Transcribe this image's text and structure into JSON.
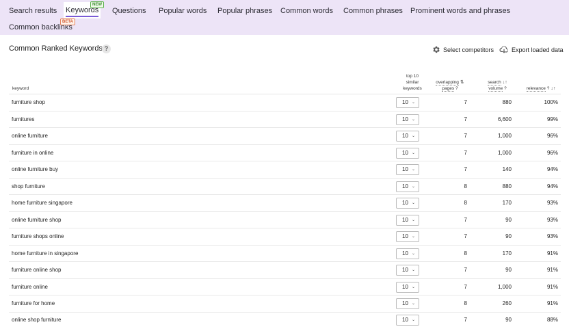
{
  "tabs": [
    {
      "label": "Search results"
    },
    {
      "label": "Keywords",
      "badge": "NEW",
      "active": true
    },
    {
      "label": "Questions"
    },
    {
      "label": "Popular words"
    },
    {
      "label": "Popular phrases"
    },
    {
      "label": "Common words"
    },
    {
      "label": "Common phrases"
    },
    {
      "label": "Prominent words and phrases"
    },
    {
      "label": "Common backlinks",
      "badge": "BETA"
    }
  ],
  "section": {
    "title": "Common Ranked Keywords",
    "help": "?",
    "select_competitors": "Select competitors",
    "export": "Export loaded data"
  },
  "table": {
    "headers": {
      "keyword": "keyword",
      "top10_line1": "top 10",
      "top10_line2": "similar",
      "top10_line3": "keywords",
      "overlap_line1": "overlapping",
      "overlap_line2": "pages",
      "volume_line1": "search",
      "volume_line2": "volume",
      "relevance": "relevance",
      "help_mark": "?"
    },
    "rows": [
      {
        "keyword": "furniture shop",
        "top10": "10",
        "overlap": "7",
        "volume": "880",
        "relevance": "100%"
      },
      {
        "keyword": "furnitures",
        "top10": "10",
        "overlap": "7",
        "volume": "6,600",
        "relevance": "99%"
      },
      {
        "keyword": "online furniture",
        "top10": "10",
        "overlap": "7",
        "volume": "1,000",
        "relevance": "96%"
      },
      {
        "keyword": "furniture in online",
        "top10": "10",
        "overlap": "7",
        "volume": "1,000",
        "relevance": "96%"
      },
      {
        "keyword": "online furniture buy",
        "top10": "10",
        "overlap": "7",
        "volume": "140",
        "relevance": "94%"
      },
      {
        "keyword": "shop furniture",
        "top10": "10",
        "overlap": "8",
        "volume": "880",
        "relevance": "94%"
      },
      {
        "keyword": "home furniture singapore",
        "top10": "10",
        "overlap": "8",
        "volume": "170",
        "relevance": "93%"
      },
      {
        "keyword": "online furniture shop",
        "top10": "10",
        "overlap": "7",
        "volume": "90",
        "relevance": "93%"
      },
      {
        "keyword": "furniture shops online",
        "top10": "10",
        "overlap": "7",
        "volume": "90",
        "relevance": "93%"
      },
      {
        "keyword": "home furniture in singapore",
        "top10": "10",
        "overlap": "8",
        "volume": "170",
        "relevance": "91%"
      },
      {
        "keyword": "furniture online shop",
        "top10": "10",
        "overlap": "7",
        "volume": "90",
        "relevance": "91%"
      },
      {
        "keyword": "furniture online",
        "top10": "10",
        "overlap": "7",
        "volume": "1,000",
        "relevance": "91%"
      },
      {
        "keyword": "furniture for home",
        "top10": "10",
        "overlap": "8",
        "volume": "260",
        "relevance": "91%"
      },
      {
        "keyword": "online shop furniture",
        "top10": "10",
        "overlap": "7",
        "volume": "90",
        "relevance": "88%"
      }
    ]
  },
  "colors": {
    "tabbar_bg": "#ede4f7",
    "active_underline": "#7a5bd6",
    "new_badge": "#58b047",
    "beta_badge": "#e4825c"
  },
  "icons": {
    "select_competitors": "gear-icon",
    "export": "cloud-download-icon",
    "dropdown": "chevron-down-icon",
    "sort": "sort-icon"
  }
}
